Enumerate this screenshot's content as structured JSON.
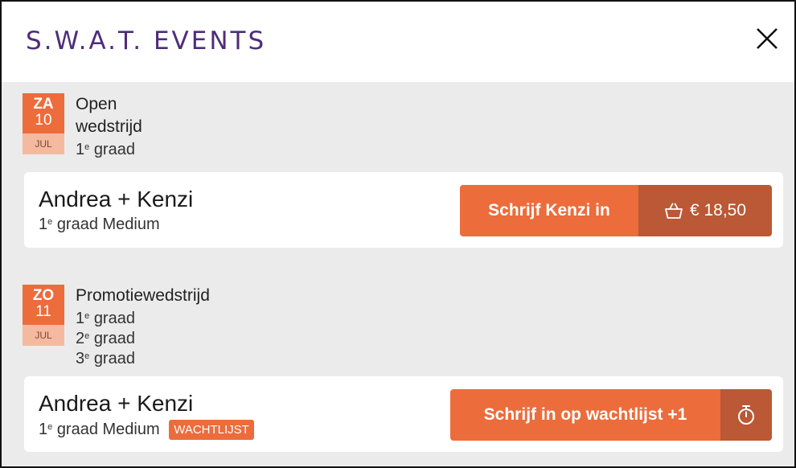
{
  "header": {
    "title": "S.W.A.T. EVENTS"
  },
  "events": [
    {
      "date": {
        "day": "ZA",
        "num": "10",
        "month": "JUL"
      },
      "title": "Open wedstrijd",
      "grades": [
        {
          "n": "1",
          "suffix": "e",
          "word": "graad"
        }
      ],
      "entry": {
        "pair": "Andrea + Kenzi",
        "grade_n": "1",
        "grade_suffix": "e",
        "grade_text": "graad Medium",
        "badge": "",
        "button_label": "Schrijf Kenzi in",
        "price": "€ 18,50",
        "side_icon": "basket-icon"
      }
    },
    {
      "date": {
        "day": "ZO",
        "num": "11",
        "month": "JUL"
      },
      "title": "Promotiewedstrijd",
      "grades": [
        {
          "n": "1",
          "suffix": "e",
          "word": "graad"
        },
        {
          "n": "2",
          "suffix": "e",
          "word": "graad"
        },
        {
          "n": "3",
          "suffix": "e",
          "word": "graad"
        }
      ],
      "entry": {
        "pair": "Andrea + Kenzi",
        "grade_n": "1",
        "grade_suffix": "e",
        "grade_text": "graad Medium",
        "badge": "WACHTLIJST",
        "button_label": "Schrijf in op wachtlijst +1",
        "price": "",
        "side_icon": "stopwatch-icon"
      }
    }
  ],
  "colors": {
    "brand": "#4e2d7a",
    "accent": "#ec6c3c",
    "accent_dark": "#bb5835",
    "date_month_bg": "#f5b9a0"
  }
}
